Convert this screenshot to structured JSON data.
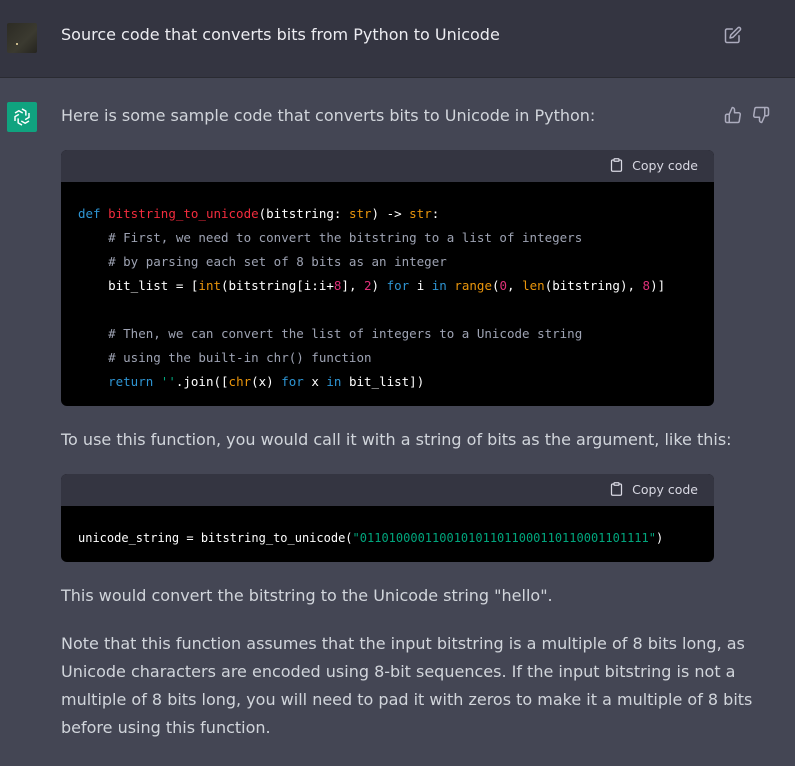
{
  "user_message": {
    "text": "Source code that converts bits from Python to Unicode"
  },
  "assistant": {
    "intro": "Here is some sample code that converts bits to Unicode in Python:",
    "copy_label": "Copy code",
    "code1": {
      "lines": [
        {
          "segments": [
            [
              "kw",
              "def "
            ],
            [
              "fn",
              "bitstring_to_unicode"
            ],
            [
              "",
              "(bitstring: "
            ],
            [
              "bi",
              "str"
            ],
            [
              "",
              ") -> "
            ],
            [
              "bi",
              "str"
            ],
            [
              "",
              ":"
            ]
          ]
        },
        {
          "segments": [
            [
              "cm",
              "    # First, we need to convert the bitstring to a list of integers"
            ]
          ]
        },
        {
          "segments": [
            [
              "cm",
              "    # by parsing each set of 8 bits as an integer"
            ]
          ]
        },
        {
          "segments": [
            [
              "",
              "    bit_list = ["
            ],
            [
              "bi",
              "int"
            ],
            [
              "",
              "(bitstring[i:i+"
            ],
            [
              "num",
              "8"
            ],
            [
              "",
              "], "
            ],
            [
              "num",
              "2"
            ],
            [
              "",
              ") "
            ],
            [
              "kw",
              "for"
            ],
            [
              "",
              " i "
            ],
            [
              "kw",
              "in"
            ],
            [
              "",
              " "
            ],
            [
              "bi",
              "range"
            ],
            [
              "",
              "("
            ],
            [
              "num",
              "0"
            ],
            [
              "",
              ", "
            ],
            [
              "bi",
              "len"
            ],
            [
              "",
              "(bitstring), "
            ],
            [
              "num",
              "8"
            ],
            [
              "",
              ")]"
            ]
          ]
        },
        {
          "segments": [
            [
              "",
              ""
            ]
          ]
        },
        {
          "segments": [
            [
              "cm",
              "    # Then, we can convert the list of integers to a Unicode string"
            ]
          ]
        },
        {
          "segments": [
            [
              "cm",
              "    # using the built-in chr() function"
            ]
          ]
        },
        {
          "segments": [
            [
              "kw",
              "    return"
            ],
            [
              "",
              " "
            ],
            [
              "str",
              "''"
            ],
            [
              "",
              ".join(["
            ],
            [
              "bi",
              "chr"
            ],
            [
              "",
              "(x) "
            ],
            [
              "kw",
              "for"
            ],
            [
              "",
              " x "
            ],
            [
              "kw",
              "in"
            ],
            [
              "",
              " bit_list])"
            ]
          ]
        }
      ]
    },
    "usage_text": "To use this function, you would call it with a string of bits as the argument, like this:",
    "code2": {
      "lines": [
        {
          "segments": [
            [
              "",
              "unicode_string = bitstring_to_unicode("
            ],
            [
              "str",
              "\"0110100001100101011011000110110001101111\""
            ],
            [
              "",
              ")"
            ]
          ]
        }
      ]
    },
    "result_text": "This would convert the bitstring to the Unicode string \"hello\".",
    "note_lines": [
      "Note that this function assumes that the input bitstring is a multiple of 8 bits long, as",
      "Unicode characters are encoded using 8-bit sequences. If the input bitstring is not a",
      "multiple of 8 bits long, you will need to pad it with zeros to make it a multiple of 8 bits",
      "before using this function."
    ]
  },
  "colors": {
    "page_bg": "#444654",
    "user_row_bg": "#343541",
    "code_bg": "#000000",
    "code_header_bg": "#343541",
    "assistant_avatar": "#10a37f",
    "keyword": "#2e95d3",
    "function_name": "#f22c3d",
    "comment": "#9ea3b3",
    "number": "#df3079",
    "string": "#00a67d",
    "builtin": "#e9950c"
  },
  "icons": [
    "edit-icon",
    "openai-logo-icon",
    "thumbs-up-icon",
    "thumbs-down-icon",
    "clipboard-icon"
  ]
}
